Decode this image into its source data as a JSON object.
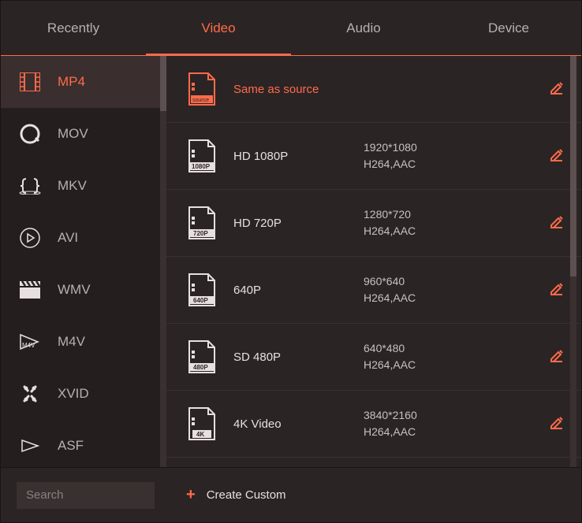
{
  "tabs": [
    {
      "label": "Recently",
      "active": false
    },
    {
      "label": "Video",
      "active": true
    },
    {
      "label": "Audio",
      "active": false
    },
    {
      "label": "Device",
      "active": false
    }
  ],
  "sidebar": {
    "items": [
      {
        "label": "MP4",
        "icon": "film",
        "active": true
      },
      {
        "label": "MOV",
        "icon": "quicktime",
        "active": false
      },
      {
        "label": "MKV",
        "icon": "braces",
        "active": false
      },
      {
        "label": "AVI",
        "icon": "play-circle",
        "active": false
      },
      {
        "label": "WMV",
        "icon": "clapper",
        "active": false
      },
      {
        "label": "M4V",
        "icon": "m4v-play",
        "active": false
      },
      {
        "label": "XVID",
        "icon": "x-cross",
        "active": false
      },
      {
        "label": "ASF",
        "icon": "triangle",
        "active": false
      }
    ]
  },
  "presets": [
    {
      "name": "Same as source",
      "accent": true,
      "icon": "source",
      "resolution": "",
      "codec": ""
    },
    {
      "name": "HD 1080P",
      "accent": false,
      "icon": "1080P",
      "resolution": "1920*1080",
      "codec": "H264,AAC"
    },
    {
      "name": "HD 720P",
      "accent": false,
      "icon": "720P",
      "resolution": "1280*720",
      "codec": "H264,AAC"
    },
    {
      "name": "640P",
      "accent": false,
      "icon": "640P",
      "resolution": "960*640",
      "codec": "H264,AAC"
    },
    {
      "name": "SD 480P",
      "accent": false,
      "icon": "480P",
      "resolution": "640*480",
      "codec": "H264,AAC"
    },
    {
      "name": "4K Video",
      "accent": false,
      "icon": "4K",
      "resolution": "3840*2160",
      "codec": "H264,AAC"
    }
  ],
  "footer": {
    "search_placeholder": "Search",
    "create_custom_label": "Create Custom"
  },
  "colors": {
    "accent": "#ff6b4a",
    "bg": "#2b2424"
  }
}
